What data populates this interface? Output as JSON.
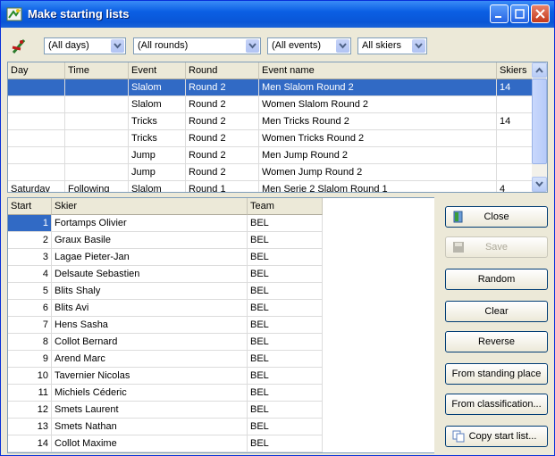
{
  "window": {
    "title": "Make starting lists"
  },
  "filters": {
    "days": "(All days)",
    "rounds": "(All rounds)",
    "events": "(All events)",
    "skiers": "All skiers"
  },
  "events_table": {
    "columns": [
      "Day",
      "Time",
      "Event",
      "Round",
      "Event name",
      "Skiers"
    ],
    "rows": [
      {
        "day": "",
        "time": "",
        "event": "Slalom",
        "round": "Round 2",
        "name": "Men Slalom Round 2",
        "skiers": "14"
      },
      {
        "day": "",
        "time": "",
        "event": "Slalom",
        "round": "Round 2",
        "name": "Women Slalom Round 2",
        "skiers": ""
      },
      {
        "day": "",
        "time": "",
        "event": "Tricks",
        "round": "Round 2",
        "name": "Men Tricks Round 2",
        "skiers": "14"
      },
      {
        "day": "",
        "time": "",
        "event": "Tricks",
        "round": "Round 2",
        "name": "Women Tricks Round 2",
        "skiers": ""
      },
      {
        "day": "",
        "time": "",
        "event": "Jump",
        "round": "Round 2",
        "name": "Men Jump Round 2",
        "skiers": ""
      },
      {
        "day": "",
        "time": "",
        "event": "Jump",
        "round": "Round 2",
        "name": "Women Jump Round 2",
        "skiers": ""
      },
      {
        "day": "Saturday",
        "time": "Following",
        "event": "Slalom",
        "round": "Round 1",
        "name": "Men Serie 2 Slalom Round 1",
        "skiers": "4"
      }
    ]
  },
  "start_table": {
    "columns": [
      "Start",
      "Skier",
      "Team"
    ],
    "rows": [
      {
        "start": "1",
        "skier": "Fortamps Olivier",
        "team": "BEL"
      },
      {
        "start": "2",
        "skier": "Graux Basile",
        "team": "BEL"
      },
      {
        "start": "3",
        "skier": "Lagae Pieter-Jan",
        "team": "BEL"
      },
      {
        "start": "4",
        "skier": "Delsaute Sebastien",
        "team": "BEL"
      },
      {
        "start": "5",
        "skier": "Blits Shaly",
        "team": "BEL"
      },
      {
        "start": "6",
        "skier": "Blits Avi",
        "team": "BEL"
      },
      {
        "start": "7",
        "skier": "Hens Sasha",
        "team": "BEL"
      },
      {
        "start": "8",
        "skier": "Collot Bernard",
        "team": "BEL"
      },
      {
        "start": "9",
        "skier": "Arend Marc",
        "team": "BEL"
      },
      {
        "start": "10",
        "skier": "Tavernier Nicolas",
        "team": "BEL"
      },
      {
        "start": "11",
        "skier": "Michiels Céderic",
        "team": "BEL"
      },
      {
        "start": "12",
        "skier": "Smets Laurent",
        "team": "BEL"
      },
      {
        "start": "13",
        "skier": "Smets Nathan",
        "team": "BEL"
      },
      {
        "start": "14",
        "skier": "Collot Maxime",
        "team": "BEL"
      }
    ]
  },
  "buttons": {
    "close": "Close",
    "save": "Save",
    "random": "Random",
    "clear": "Clear",
    "reverse": "Reverse",
    "from_standing": "From standing place",
    "from_classification": "From classification...",
    "copy_start": "Copy start list..."
  },
  "colors": {
    "titlebar": "#0b5fe4",
    "selection": "#316ac5"
  }
}
